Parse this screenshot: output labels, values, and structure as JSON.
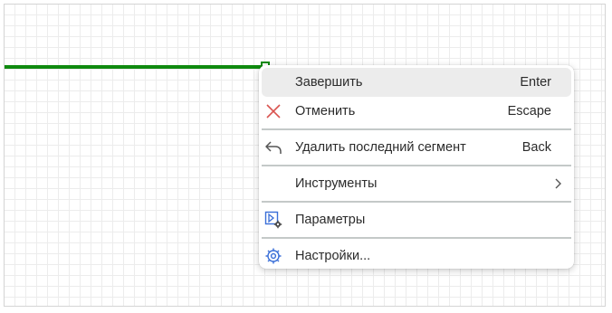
{
  "colors": {
    "segment": "#0f8a0f",
    "cancel_icon": "#d9534f",
    "settings_icon": "#3a6fd8",
    "hover_bg": "#ececec"
  },
  "canvas": {
    "grid": true
  },
  "context_menu": {
    "items": [
      {
        "label": "Завершить",
        "shortcut": "Enter",
        "icon": "none"
      },
      {
        "label": "Отменить",
        "shortcut": "Escape",
        "icon": "close-icon"
      },
      {
        "label": "Удалить последний сегмент",
        "shortcut": "Back",
        "icon": "undo-arrow-icon"
      },
      {
        "label": "Инструменты",
        "shortcut": "",
        "icon": "chevron-right-icon"
      },
      {
        "label": "Параметры",
        "shortcut": "",
        "icon": "parameters-icon"
      },
      {
        "label": "Настройки...",
        "shortcut": "",
        "icon": "gear-icon"
      }
    ]
  }
}
